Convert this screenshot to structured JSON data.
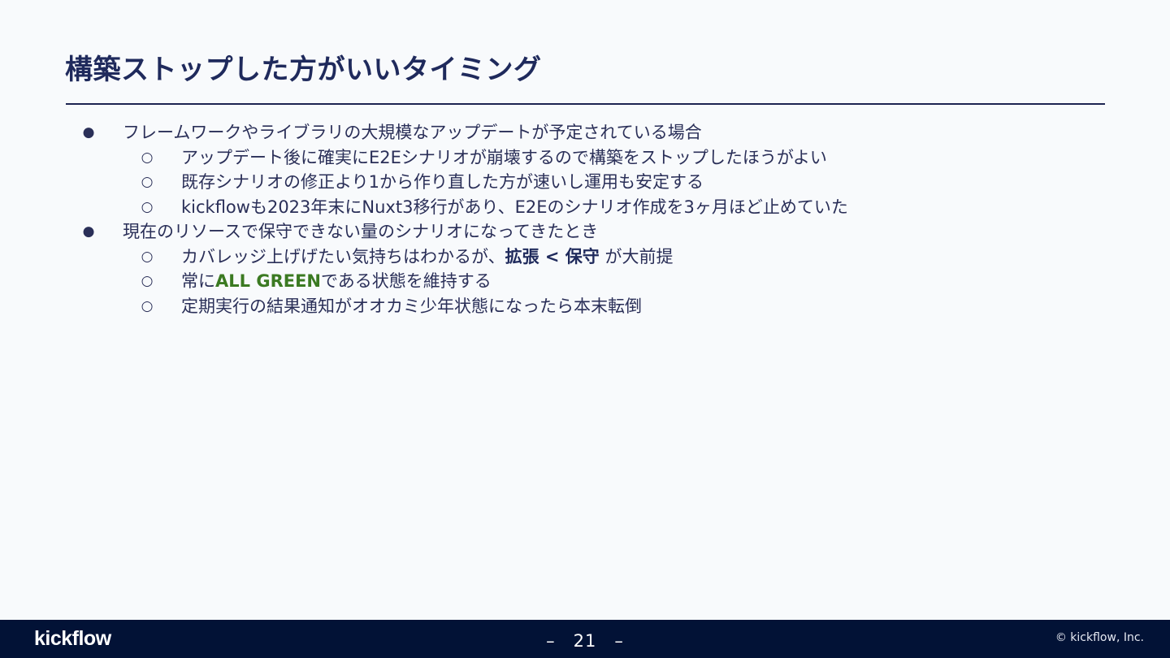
{
  "slide": {
    "title": "構築ストップした方がいいタイミング"
  },
  "bullets": [
    {
      "level": 1,
      "marker": "●",
      "text": "フレームワークやライブラリの大規模なアップデートが予定されている場合"
    },
    {
      "level": 2,
      "marker": "○",
      "text": "アップデート後に確実にE2Eシナリオが崩壊するので構築をストップしたほうがよい"
    },
    {
      "level": 2,
      "marker": "○",
      "text": "既存シナリオの修正より1から作り直した方が速いし運用も安定する"
    },
    {
      "level": 2,
      "marker": "○",
      "text": "kickflowも2023年末にNuxt3移行があり、E2Eのシナリオ作成を3ヶ月ほど止めていた"
    },
    {
      "level": 1,
      "marker": "●",
      "text": "現在のリソースで保守できない量のシナリオになってきたとき"
    },
    {
      "level": 2,
      "marker": "○",
      "text_before": "カバレッジ上げげたい気持ちはわかるが、",
      "text_strong": "拡張 < 保守",
      "text_after": " が大前提"
    },
    {
      "level": 2,
      "marker": "○",
      "text_before": "常に",
      "text_green": "ALL GREEN",
      "text_after": "である状態を維持する"
    },
    {
      "level": 2,
      "marker": "○",
      "text": "定期実行の結果通知がオオカミ少年状態になったら本末転倒"
    }
  ],
  "footer": {
    "logo": "kickflow",
    "page_number": "–　21　–",
    "copyright": "© kickflow, Inc."
  },
  "colors": {
    "background": "#f8fafc",
    "title": "#1f2a5c",
    "text": "#2a2f58",
    "accent_green": "#3b7a22",
    "footer_bg": "#021236"
  }
}
